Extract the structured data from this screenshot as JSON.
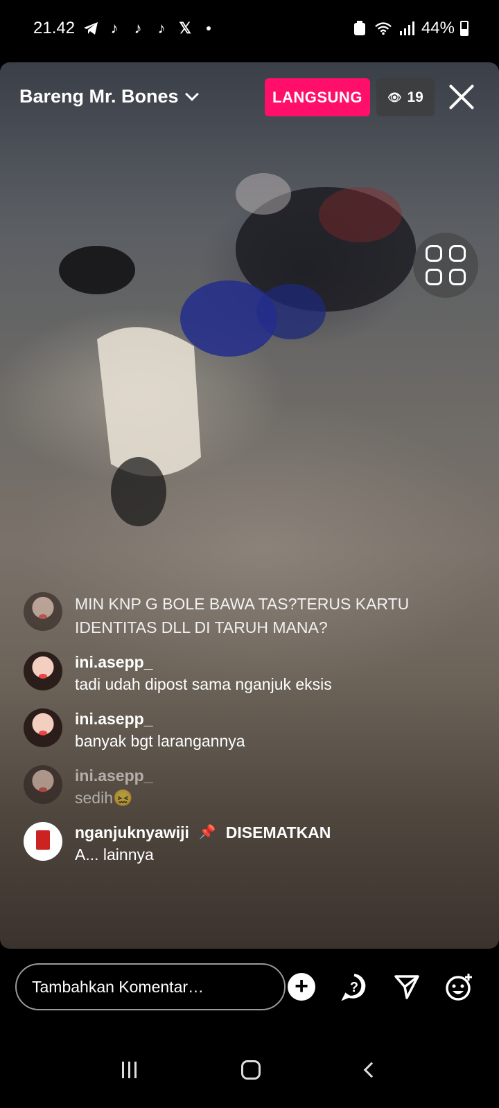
{
  "status_bar": {
    "time": "21.42",
    "battery": "44%",
    "notification_icons": [
      "telegram-icon",
      "tiktok-icon",
      "tiktok-icon",
      "tiktok-icon",
      "x-icon"
    ]
  },
  "live": {
    "title": "Bareng Mr. Bones",
    "badge": "LANGSUNG",
    "viewers": "19"
  },
  "comments": [
    {
      "user": "",
      "text": "MIN KNP G BOLE BAWA TAS?TERUS KARTU IDENTITAS DLL DI TARUH MANA?"
    },
    {
      "user": "ini.asepp_",
      "text": "tadi udah dipost sama nganjuk eksis"
    },
    {
      "user": "ini.asepp_",
      "text": "banyak bgt larangannya"
    },
    {
      "user": "ini.asepp_",
      "text": "sedih😖"
    },
    {
      "user": "nganjuknyawiji",
      "pinned_label": "DISEMATKAN",
      "text": "A... lainnya"
    }
  ],
  "composer": {
    "placeholder": "Tambahkan Komentar…"
  },
  "colors": {
    "live_badge": "#ff0f6a",
    "background": "#000000"
  }
}
